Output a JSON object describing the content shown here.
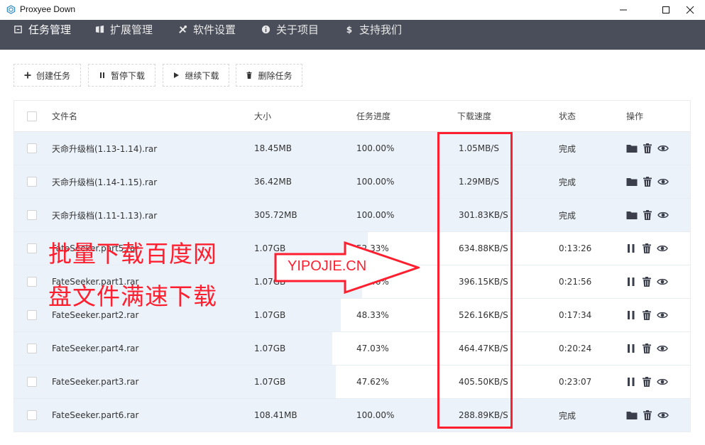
{
  "window": {
    "title": "Proxyee Down"
  },
  "nav": {
    "items": [
      {
        "label": "任务管理",
        "icon": "task-icon",
        "active": true
      },
      {
        "label": "扩展管理",
        "icon": "extension-icon",
        "active": false
      },
      {
        "label": "软件设置",
        "icon": "tools-icon",
        "active": false
      },
      {
        "label": "关于项目",
        "icon": "info-icon",
        "active": false
      },
      {
        "label": "支持我们",
        "icon": "dollar-icon",
        "active": false
      }
    ]
  },
  "toolbar": {
    "create_label": "创建任务",
    "pause_label": "暂停下载",
    "resume_label": "继续下载",
    "delete_label": "删除任务"
  },
  "table": {
    "headers": {
      "name": "文件名",
      "size": "大小",
      "progress": "任务进度",
      "speed": "下载速度",
      "status": "状态",
      "actions": "操作"
    },
    "rows": [
      {
        "name": "天命升级档(1.13-1.14).rar",
        "size": "18.45MB",
        "progress": "100.00%",
        "progress_value": 100.0,
        "speed": "1.05MB/S",
        "status": "完成",
        "done": true
      },
      {
        "name": "天命升级档(1.14-1.15).rar",
        "size": "36.42MB",
        "progress": "100.00%",
        "progress_value": 100.0,
        "speed": "1.29MB/S",
        "status": "完成",
        "done": true
      },
      {
        "name": "天命升级档(1.11-1.13).rar",
        "size": "305.72MB",
        "progress": "100.00%",
        "progress_value": 100.0,
        "speed": "301.83KB/S",
        "status": "完成",
        "done": true
      },
      {
        "name": "FateSeeker.part5.rar",
        "size": "1.07GB",
        "progress": "52.33%",
        "progress_value": 52.33,
        "speed": "634.88KB/S",
        "status": "0:13:26",
        "done": false
      },
      {
        "name": "FateSeeker.part1.rar",
        "size": "1.07GB",
        "progress": "51.46%",
        "progress_value": 51.46,
        "speed": "396.15KB/S",
        "status": "0:21:56",
        "done": false
      },
      {
        "name": "FateSeeker.part2.rar",
        "size": "1.07GB",
        "progress": "48.33%",
        "progress_value": 48.33,
        "speed": "526.16KB/S",
        "status": "0:17:34",
        "done": false
      },
      {
        "name": "FateSeeker.part4.rar",
        "size": "1.07GB",
        "progress": "47.03%",
        "progress_value": 47.03,
        "speed": "464.47KB/S",
        "status": "0:20:24",
        "done": false
      },
      {
        "name": "FateSeeker.part3.rar",
        "size": "1.07GB",
        "progress": "47.62%",
        "progress_value": 47.62,
        "speed": "405.50KB/S",
        "status": "0:23:07",
        "done": false
      },
      {
        "name": "FateSeeker.part6.rar",
        "size": "108.41MB",
        "progress": "100.00%",
        "progress_value": 100.0,
        "speed": "288.89KB/S",
        "status": "完成",
        "done": true
      }
    ]
  },
  "overlay": {
    "line1": "批量下载百度网",
    "line2": "盘文件满速下载",
    "arrow_text": "YIPOJIE.CN"
  },
  "colors": {
    "nav_bg": "#4a4e5a",
    "progress_fill": "#ebf2fa",
    "highlight_red": "#ff1f2e",
    "icon_dark": "#3a3f4b"
  }
}
